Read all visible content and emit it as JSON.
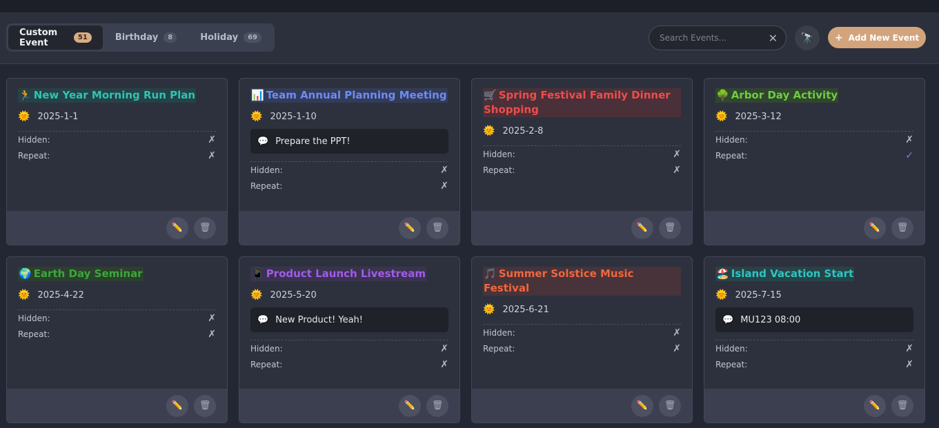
{
  "tabs": [
    {
      "label": "Custom Event",
      "count": "51",
      "active": true
    },
    {
      "label": "Birthday",
      "count": "8",
      "active": false
    },
    {
      "label": "Holiday",
      "count": "69",
      "active": false
    }
  ],
  "search": {
    "placeholder": "Search Events...",
    "clear_icon": "✕"
  },
  "scope_icon": "🔭",
  "add_button": {
    "plus": "+",
    "label": "Add New Event"
  },
  "labels": {
    "hidden": "Hidden:",
    "repeat": "Repeat:"
  },
  "icons": {
    "sun": "🌞",
    "note": "💬",
    "edit": "✏️",
    "delete": "🗑",
    "cross": "✗",
    "check": "✓"
  },
  "events": [
    {
      "emoji": "🏃",
      "title": "New Year Morning Run Plan",
      "color": "#2fc4b2",
      "bg": "#254246",
      "date": "2025-1-1",
      "note": "",
      "hidden": "✗",
      "repeat": "✗"
    },
    {
      "emoji": "📊",
      "title": "Team Annual Planning Meeting",
      "color": "#6d8cf2",
      "bg": "#333b59",
      "date": "2025-1-10",
      "note": "Prepare the PPT!",
      "hidden": "✗",
      "repeat": "✗"
    },
    {
      "emoji": "🛒",
      "title": "Spring Festival Family Dinner Shopping",
      "color": "#f04c4c",
      "bg": "#4a3038",
      "date": "2025-2-8",
      "note": "",
      "hidden": "✗",
      "repeat": "✗"
    },
    {
      "emoji": "🌳",
      "title": "Arbor Day Activity",
      "color": "#6ccf3e",
      "bg": "#314530",
      "date": "2025-3-12",
      "note": "",
      "hidden": "✗",
      "repeat": "✓"
    },
    {
      "emoji": "🌍",
      "title": "Earth Day Seminar",
      "color": "#3ba83b",
      "bg": "#2c402e",
      "date": "2025-4-22",
      "note": "",
      "hidden": "✗",
      "repeat": "✗"
    },
    {
      "emoji": "📱",
      "title": "Product Launch Livestream",
      "color": "#a05ce8",
      "bg": "#3a3350",
      "date": "2025-5-20",
      "note": "New Product! Yeah!",
      "hidden": "✗",
      "repeat": "✗"
    },
    {
      "emoji": "🎵",
      "title": "Summer Solstice Music Festival",
      "color": "#f0673e",
      "bg": "#48333a",
      "date": "2025-6-21",
      "note": "",
      "hidden": "✗",
      "repeat": "✗"
    },
    {
      "emoji": "🏖️",
      "title": "Island Vacation Start",
      "color": "#2fc4c4",
      "bg": "#264448",
      "date": "2025-7-15",
      "note": "MU123 08:00",
      "hidden": "✗",
      "repeat": "✗"
    }
  ]
}
